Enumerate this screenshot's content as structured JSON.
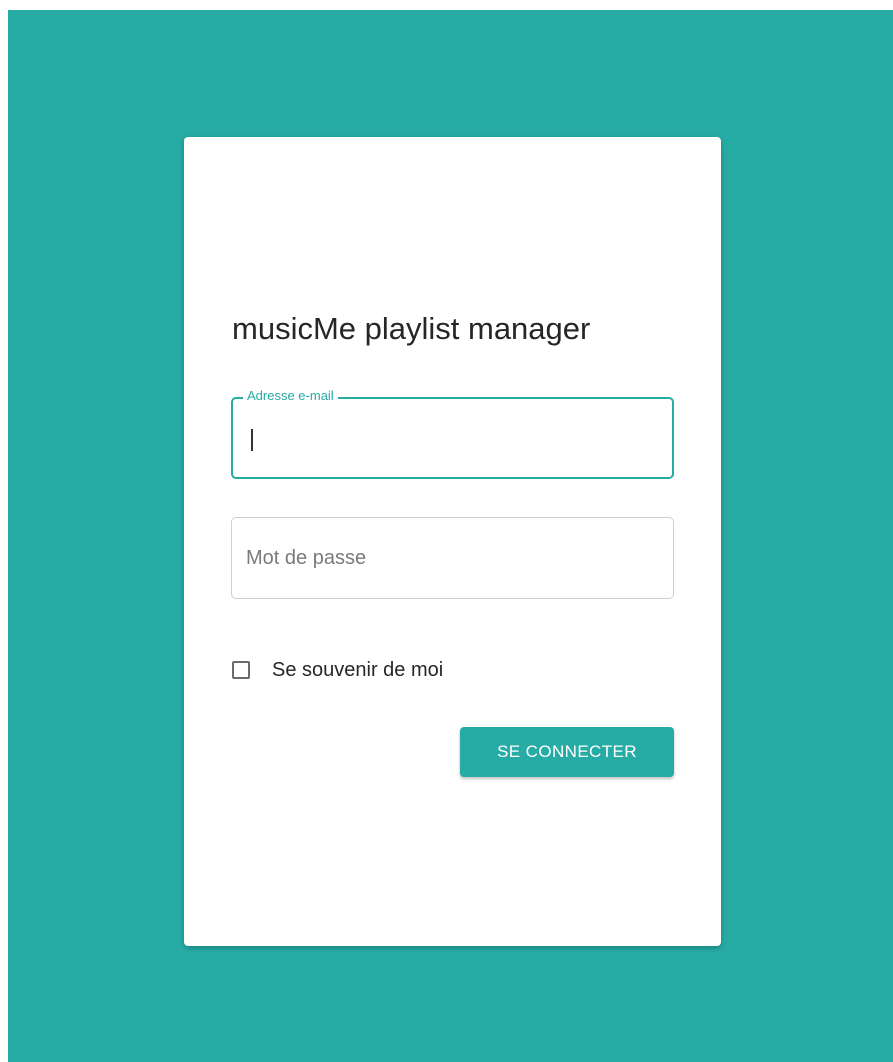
{
  "app": {
    "title": "musicMe playlist manager"
  },
  "login": {
    "email": {
      "label": "Adresse e-mail",
      "value": ""
    },
    "password": {
      "placeholder": "Mot de passe",
      "value": ""
    },
    "remember": {
      "label": "Se souvenir de moi",
      "checked": false
    },
    "submit_label": "SE CONNECTER"
  },
  "colors": {
    "accent": "#27aca5",
    "background": "#27aca5",
    "card": "#ffffff",
    "text": "#262626"
  }
}
